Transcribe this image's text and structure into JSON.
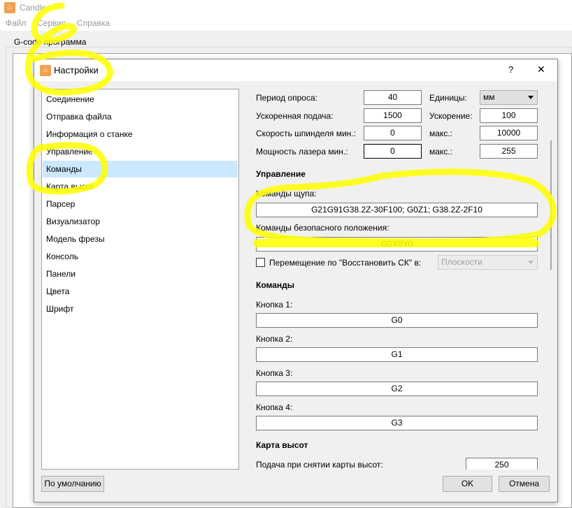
{
  "app": {
    "title": "Candle",
    "menu": [
      "Файл",
      "Сервис",
      "Справка"
    ],
    "group_title": "G-code программа"
  },
  "dialog": {
    "title": "Настройки",
    "help": "?",
    "close": "✕",
    "nav": [
      "Соединение",
      "Отправка файла",
      "Информация о станке",
      "Управление",
      "Команды",
      "Карта высот",
      "Парсер",
      "Визуализатор",
      "Модель фрезы",
      "Консоль",
      "Панели",
      "Цвета",
      "Шрифт"
    ],
    "selected_nav": "Команды",
    "machine": {
      "poll_label": "Период опроса:",
      "poll": "40",
      "units_label": "Единицы:",
      "units": "мм",
      "rapid_label": "Ускоренная подача:",
      "rapid": "1500",
      "accel_label": "Ускорение:",
      "accel": "100",
      "spindle_label": "Скорость шпинделя мин.:",
      "spindle_min": "0",
      "spindle_max_label": "макс.:",
      "spindle_max": "10000",
      "laser_label": "Мощность лазера мин.:",
      "laser_min": "0",
      "laser_max_label": "макс.:",
      "laser_max": "255"
    },
    "control": {
      "heading": "Управление",
      "probe_label": "Команды щупа:",
      "probe": "G21G91G38.2Z-30F100; G0Z1; G38.2Z-2F10",
      "safe_label": "Команды безопасного положения:",
      "safe": "G0X0Y0",
      "restore_label": "Перемещение по \"Восстановить СК\" в:",
      "restore_checked": false,
      "restore_value": "Плоскости"
    },
    "commands": {
      "heading": "Команды",
      "buttons": [
        {
          "label": "Кнопка 1:",
          "value": "G0"
        },
        {
          "label": "Кнопка 2:",
          "value": "G1"
        },
        {
          "label": "Кнопка 3:",
          "value": "G2"
        },
        {
          "label": "Кнопка 4:",
          "value": "G3"
        }
      ]
    },
    "heightmap": {
      "heading": "Карта высот",
      "feed_label": "Подача при снятии карты высот:",
      "feed": "250"
    },
    "defaults_button": "По умолчанию",
    "ok_button": "OK",
    "cancel_button": "Отмена"
  },
  "colors": {
    "selection": "#cce8ff",
    "annotation": "#ffff00",
    "app_icon": "#f0a050"
  }
}
